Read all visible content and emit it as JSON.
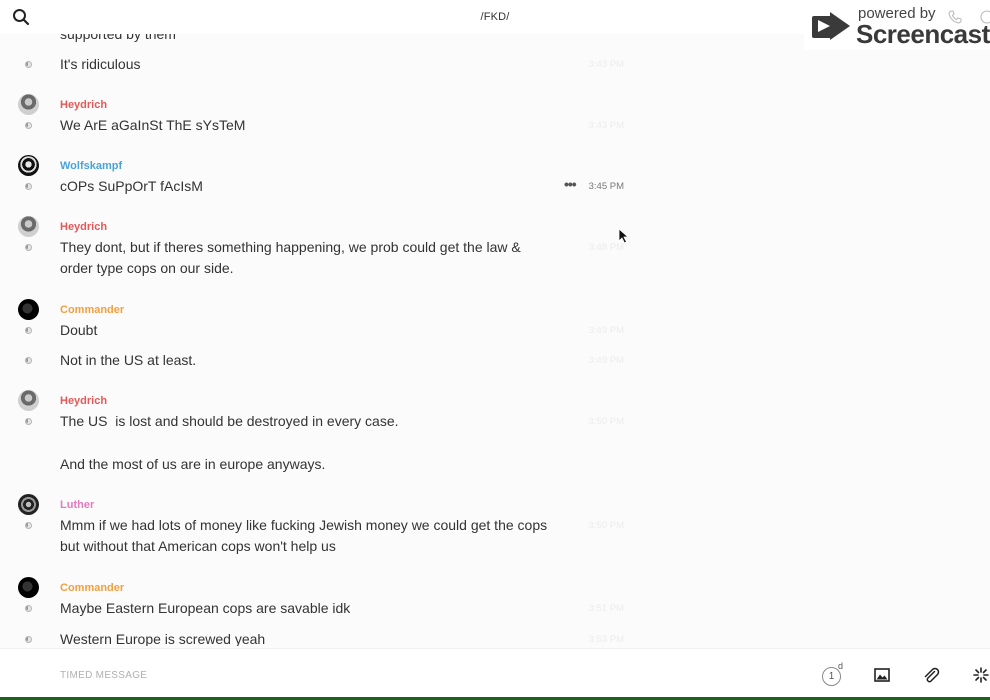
{
  "header": {
    "channel": "/FKD/",
    "search_icon": "search-icon"
  },
  "overlay": {
    "powered_by": "powered by",
    "brand": "Screencastify"
  },
  "chat": {
    "partial_message": "supported by them",
    "messages": [
      {
        "author": "",
        "text": "It's ridiculous",
        "time": "3:43 PM"
      },
      {
        "author": "Heydrich",
        "text": "We ArE aGaInSt ThE sYsTeM",
        "time": "3:43 PM"
      },
      {
        "author": "Wolfskampf",
        "text": "cOPs SuPpOrT fAcIsM",
        "time": "3:45 PM"
      },
      {
        "author": "Heydrich",
        "text": "They dont, but if theres something happening, we prob could get the law & order type cops on our side.",
        "time": "3:48 PM"
      },
      {
        "author": "Commander",
        "text": "Doubt",
        "time": "3:49 PM"
      },
      {
        "author": "",
        "text": "Not in the US at least.",
        "time": "3:49 PM"
      },
      {
        "author": "Heydrich",
        "text": "The US  is lost and should be destroyed in every case.",
        "time": "3:50 PM"
      },
      {
        "author": "",
        "text": "And the most of us are in europe anyways.",
        "time": ""
      },
      {
        "author": "Luther",
        "text": "Mmm if we had lots of money like fucking Jewish money we could get the cops but without that American cops won't help us",
        "time": "3:50 PM"
      },
      {
        "author": "Commander",
        "text": "Maybe Eastern European cops are savable idk",
        "time": "3:51 PM"
      },
      {
        "author": "",
        "text": "Western Europe is screwed yeah",
        "time": "3:53 PM"
      }
    ]
  },
  "colors": {
    "heydrich": "#e05a5a",
    "wolfskampf": "#4aa3d8",
    "commander": "#f0a040",
    "luther": "#e27bbf"
  },
  "composer": {
    "placeholder": "TIMED MESSAGE",
    "timer_value": "1",
    "timer_unit": "d"
  }
}
